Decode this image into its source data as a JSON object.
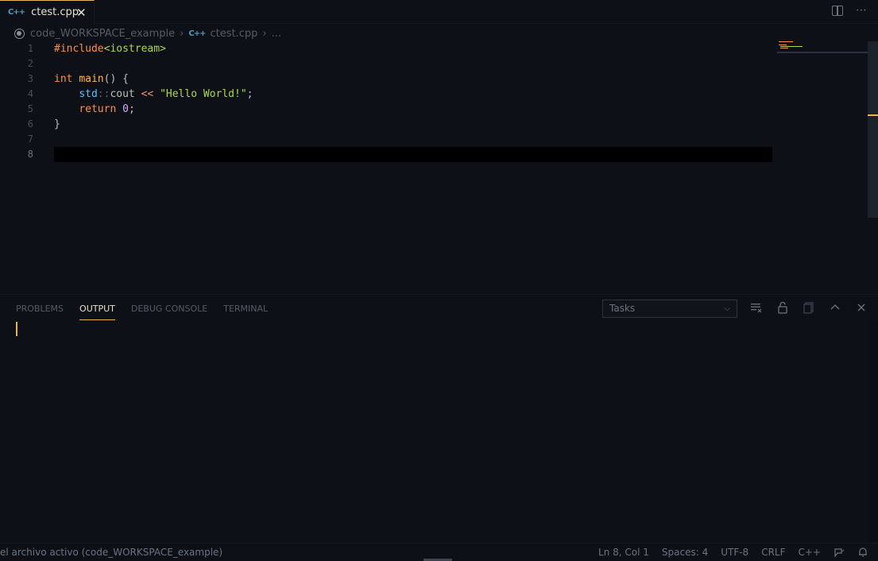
{
  "tab": {
    "icon": "cpp-icon",
    "icon_text": "C++",
    "label": "ctest.cpp",
    "close": "✕"
  },
  "tabbar_actions": {
    "split": "split-editor-icon",
    "more": "⋯"
  },
  "breadcrumb": {
    "workspace": "code_WORKSPACE_example",
    "sep1": "›",
    "file_icon_text": "C++",
    "file": "ctest.cpp",
    "sep2": "›",
    "ellipsis": "..."
  },
  "gutter": [
    "1",
    "2",
    "3",
    "4",
    "5",
    "6",
    "7",
    "8"
  ],
  "code": {
    "l1_pp": "#include",
    "l1_inc": "<iostream>",
    "l3_kw": "int",
    "l3_sp": " ",
    "l3_fn": "main",
    "l3_rest": "() {",
    "l4_indent": "    ",
    "l4_ns": "std",
    "l4_sep": "::",
    "l4_id": "cout",
    "l4_sp1": " ",
    "l4_op": "<<",
    "l4_sp2": " ",
    "l4_str": "\"Hello World!\"",
    "l4_semi": ";",
    "l5_indent": "    ",
    "l5_kw": "return",
    "l5_sp": " ",
    "l5_num": "0",
    "l5_semi": ";",
    "l6": "}"
  },
  "panel": {
    "tabs": [
      "PROBLEMS",
      "OUTPUT",
      "DEBUG CONSOLE",
      "TERMINAL"
    ],
    "active_tab": "OUTPUT",
    "select_value": "Tasks",
    "chevron": "⌵"
  },
  "status": {
    "left": "el archivo activo (code_WORKSPACE_example)",
    "position": "Ln 8, Col 1",
    "spaces": "Spaces: 4",
    "encoding": "UTF-8",
    "eol": "CRLF",
    "language": "C++"
  },
  "colors": {
    "accent": "#e6b450",
    "background": "#0d1017",
    "keyword": "#ff8f40",
    "string": "#aad94c",
    "namespace": "#59c2ff",
    "number": "#d2a6ff"
  }
}
